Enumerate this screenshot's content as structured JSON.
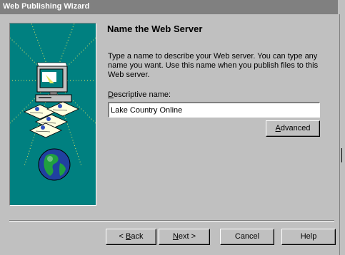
{
  "window": {
    "title": "Web Publishing Wizard"
  },
  "page": {
    "heading": "Name the Web Server",
    "description": "Type a name to describe your Web server. You can type any name you want. Use this name when you publish files to this Web server.",
    "field_label_mnemonic": "D",
    "field_label_rest": "escriptive name:",
    "field_value": "Lake Country Online"
  },
  "buttons": {
    "advanced_mnemonic": "A",
    "advanced_rest": "dvanced",
    "back_prefix": "< ",
    "back_mnemonic": "B",
    "back_rest": "ack",
    "next_mnemonic": "N",
    "next_rest": "ext >",
    "cancel": "Cancel",
    "help": "Help"
  },
  "illustration": {
    "background_color": "#008080",
    "icons": [
      "computer-icon",
      "document-icon",
      "globe-icon"
    ]
  }
}
